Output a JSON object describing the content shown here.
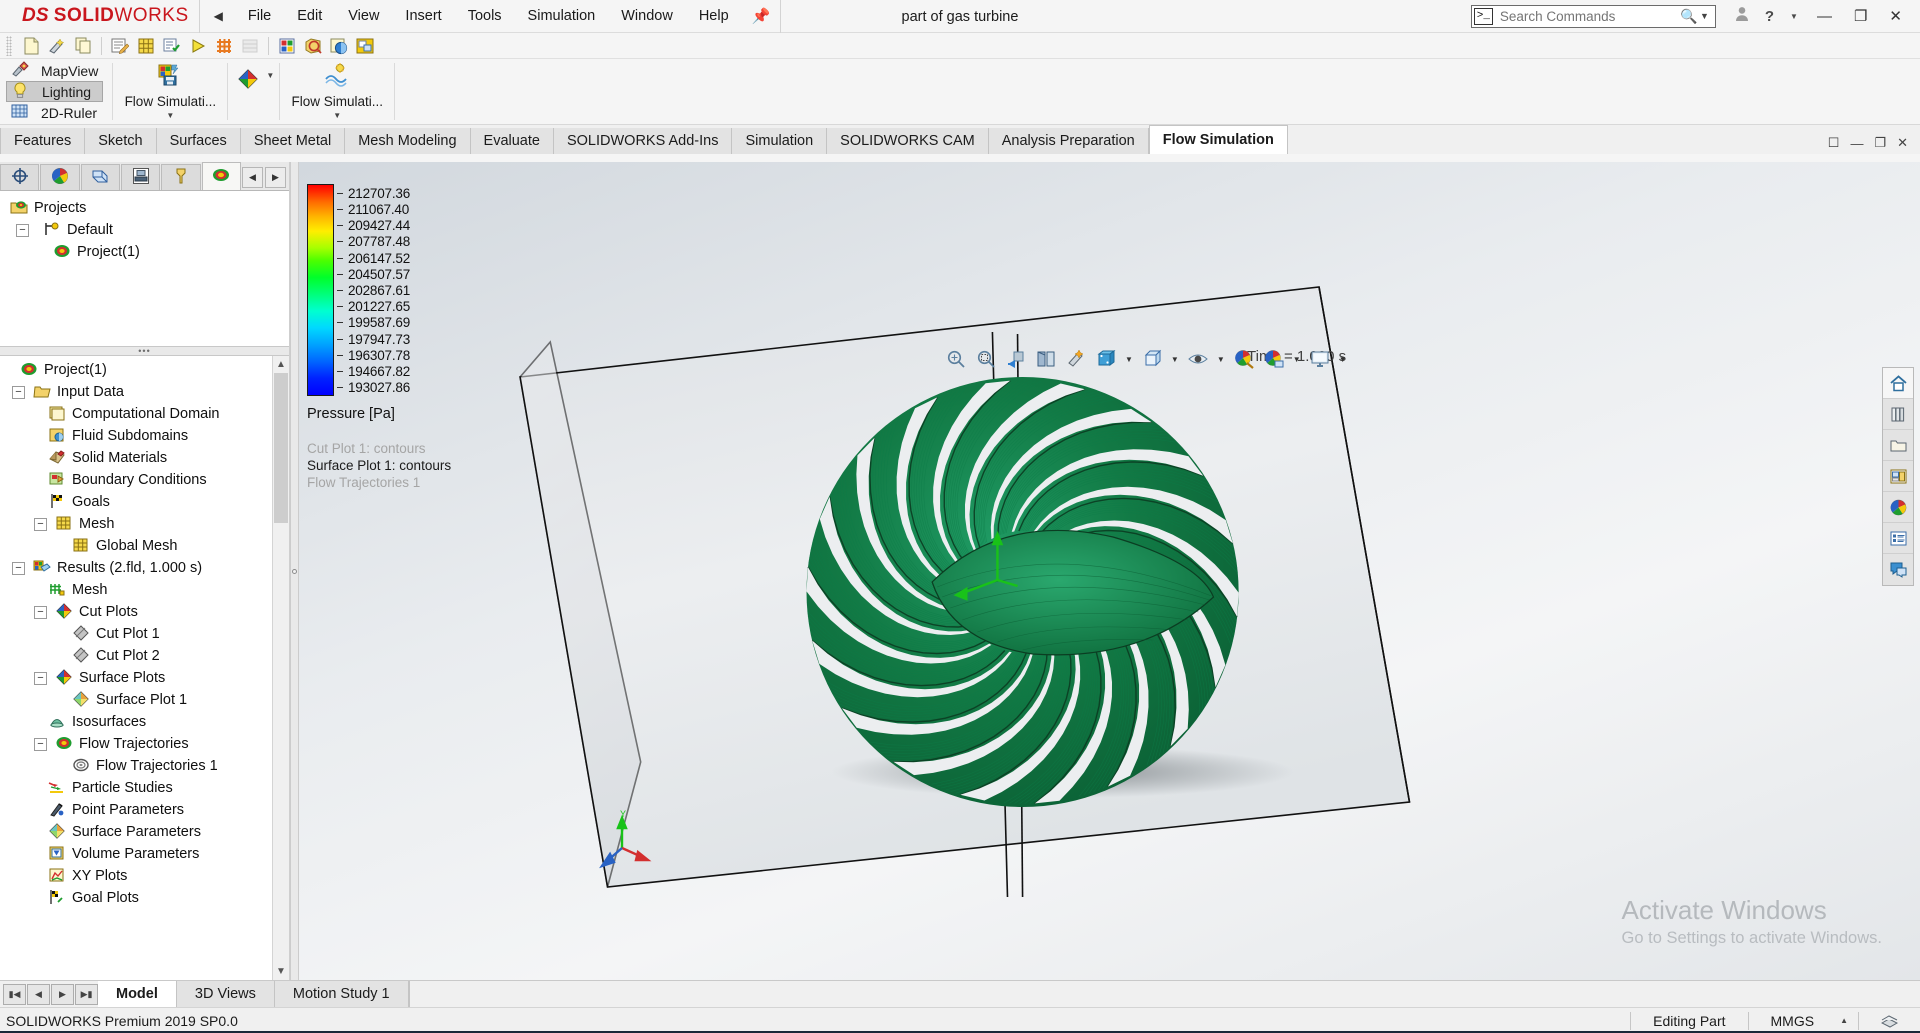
{
  "window": {
    "title": "part of gas turbine",
    "brand_ds": "DS",
    "brand_solid": "SOLID",
    "brand_works": "WORKS",
    "brand_color": "#c9161d"
  },
  "menu": {
    "collapse_icon": "chevron-left-icon",
    "items": [
      "File",
      "Edit",
      "View",
      "Insert",
      "Tools",
      "Simulation",
      "Window",
      "Help"
    ],
    "pin_icon": "pin-icon"
  },
  "search": {
    "placeholder": "Search Commands",
    "value": "",
    "icon": "search-icon",
    "dropdown_icon": "chevron-down-icon"
  },
  "title_right": {
    "account_icon": "user-account-icon",
    "help_icon": "help-icon",
    "help_caret": "chevron-down-icon",
    "minimize": "minimize-icon",
    "restore": "restore-icon",
    "close": "close-icon"
  },
  "quick_access": {
    "buttons": [
      "new-document-icon",
      "rebuild-icon",
      "copy-icon",
      "edit-definition-icon",
      "mesh-icon",
      "run-settings-icon",
      "run-icon",
      "mesh-grid-icon",
      "section-icon",
      "results-icon",
      "zoom-results-icon",
      "color-sphere-icon",
      "window-icon"
    ]
  },
  "ribbon": {
    "display_group": {
      "items": [
        {
          "label": "MapView",
          "icon": "mapview-icon",
          "selected": false
        },
        {
          "label": "Lighting",
          "icon": "lightbulb-icon",
          "selected": true
        },
        {
          "label": "2D-Ruler",
          "icon": "ruler-grid-icon",
          "selected": false
        }
      ]
    },
    "big_buttons": [
      {
        "label": "Flow Simulati...",
        "icon": "flow-simulation-project-icon",
        "dropdown": true
      },
      {
        "label": "Flow Simulati...",
        "icon": "flow-simulation-results-icon",
        "dropdown": true
      }
    ],
    "small_buttons": [
      {
        "icon": "flow-options-icon",
        "dropdown": true
      }
    ]
  },
  "tabs": {
    "items": [
      "Features",
      "Sketch",
      "Surfaces",
      "Sheet Metal",
      "Mesh Modeling",
      "Evaluate",
      "SOLIDWORKS Add-Ins",
      "Simulation",
      "SOLIDWORKS CAM",
      "Analysis Preparation",
      "Flow Simulation"
    ],
    "active": "Flow Simulation",
    "window_controls": [
      "pin-window-icon",
      "minimize-doc-icon",
      "restore-doc-icon",
      "close-doc-icon"
    ]
  },
  "left_panel": {
    "tabs": [
      {
        "icon": "feature-manager-icon",
        "active": false
      },
      {
        "icon": "property-manager-icon",
        "active": false
      },
      {
        "icon": "configuration-manager-icon",
        "active": false
      },
      {
        "icon": "dimxpert-manager-icon",
        "active": false
      },
      {
        "icon": "cam-manager-icon",
        "active": false
      },
      {
        "icon": "flow-simulation-manager-icon",
        "active": true
      }
    ],
    "nav_prev": "chevron-left-icon",
    "nav_next": "chevron-right-icon",
    "projects_tree": [
      {
        "label": "Projects",
        "depth": 0,
        "icon": "projects-folder-icon",
        "expander": ""
      },
      {
        "label": "Default",
        "depth": 1,
        "icon": "configuration-icon",
        "expander": "-"
      },
      {
        "label": "Project(1)",
        "depth": 2,
        "icon": "project-icon",
        "expander": ""
      }
    ],
    "splitter_dots": "•••",
    "study_tree": [
      {
        "label": "Project(1)",
        "depth": 0,
        "icon": "project-icon",
        "expander": ""
      },
      {
        "label": "Input Data",
        "depth": 1,
        "icon": "input-data-folder-icon",
        "expander": "-"
      },
      {
        "label": "Computational Domain",
        "depth": 2,
        "icon": "computational-domain-icon",
        "expander": ""
      },
      {
        "label": "Fluid Subdomains",
        "depth": 2,
        "icon": "fluid-subdomains-icon",
        "expander": ""
      },
      {
        "label": "Solid Materials",
        "depth": 2,
        "icon": "solid-materials-icon",
        "expander": ""
      },
      {
        "label": "Boundary Conditions",
        "depth": 2,
        "icon": "boundary-conditions-icon",
        "expander": ""
      },
      {
        "label": "Goals",
        "depth": 2,
        "icon": "goals-flag-icon",
        "expander": ""
      },
      {
        "label": "Mesh",
        "depth": 2,
        "icon": "mesh-icon",
        "expander": "-"
      },
      {
        "label": "Global Mesh",
        "depth": 3,
        "icon": "mesh-icon",
        "expander": ""
      },
      {
        "label": "Results (2.fld, 1.000 s)",
        "depth": 1,
        "icon": "results-icon",
        "expander": "-"
      },
      {
        "label": "Mesh",
        "depth": 2,
        "icon": "results-mesh-icon",
        "expander": ""
      },
      {
        "label": "Cut Plots",
        "depth": 2,
        "icon": "cut-plots-icon",
        "expander": "-"
      },
      {
        "label": "Cut Plot 1",
        "depth": 3,
        "icon": "cut-plot-item-icon",
        "expander": ""
      },
      {
        "label": "Cut Plot 2",
        "depth": 3,
        "icon": "cut-plot-item-icon",
        "expander": ""
      },
      {
        "label": "Surface Plots",
        "depth": 2,
        "icon": "surface-plots-icon",
        "expander": "-"
      },
      {
        "label": "Surface Plot 1",
        "depth": 3,
        "icon": "surface-plot-item-icon",
        "expander": ""
      },
      {
        "label": "Isosurfaces",
        "depth": 2,
        "icon": "isosurfaces-icon",
        "expander": ""
      },
      {
        "label": "Flow Trajectories",
        "depth": 2,
        "icon": "flow-trajectories-icon",
        "expander": "-"
      },
      {
        "label": "Flow Trajectories 1",
        "depth": 3,
        "icon": "flow-trajectory-item-icon",
        "expander": ""
      },
      {
        "label": "Particle Studies",
        "depth": 2,
        "icon": "particle-studies-icon",
        "expander": ""
      },
      {
        "label": "Point Parameters",
        "depth": 2,
        "icon": "point-parameters-icon",
        "expander": ""
      },
      {
        "label": "Surface Parameters",
        "depth": 2,
        "icon": "surface-parameters-icon",
        "expander": ""
      },
      {
        "label": "Volume Parameters",
        "depth": 2,
        "icon": "volume-parameters-icon",
        "expander": ""
      },
      {
        "label": "XY Plots",
        "depth": 2,
        "icon": "xy-plots-icon",
        "expander": ""
      },
      {
        "label": "Goal Plots",
        "depth": 2,
        "icon": "goal-plots-icon",
        "expander": ""
      }
    ]
  },
  "legend": {
    "title": "Pressure [Pa]",
    "unit": "Pa",
    "parameter": "Pressure",
    "values": [
      "212707.36",
      "211067.40",
      "209427.44",
      "207787.48",
      "206147.52",
      "204507.57",
      "202867.61",
      "201227.65",
      "199587.69",
      "197947.73",
      "196307.78",
      "194667.82",
      "193027.86"
    ],
    "min": 193027.86,
    "max": 212707.36,
    "colors_top_to_bottom": [
      "#ff0000",
      "#ff8800",
      "#ffff00",
      "#88ff00",
      "#00ff44",
      "#00ffcc",
      "#00aaff",
      "#0000ff"
    ]
  },
  "plot_captions": [
    {
      "text": "Cut Plot 1: contours",
      "active": false
    },
    {
      "text": "Surface Plot 1: contours",
      "active": true
    },
    {
      "text": "Flow Trajectories 1",
      "active": false
    }
  ],
  "graphics": {
    "time_label": "Time = 1.000 s",
    "view_toolbar": [
      "zoom-to-fit-icon",
      "zoom-to-area-icon",
      "previous-view-icon",
      "section-view-icon",
      "dynamic-annotation-icon",
      "view-orientation-icon",
      "display-style-icon",
      "hide-show-icon",
      "appearances-icon",
      "scene-icon",
      "view-settings-icon"
    ],
    "triad_labels": {
      "y": "Y",
      "x": "X",
      "z": "Z"
    }
  },
  "right_tools": [
    {
      "icon": "home-icon",
      "selected": true
    },
    {
      "icon": "design-library-icon",
      "selected": false
    },
    {
      "icon": "file-explorer-icon",
      "selected": false
    },
    {
      "icon": "view-palette-icon",
      "selected": false
    },
    {
      "icon": "appearances-sphere-icon",
      "selected": false
    },
    {
      "icon": "custom-properties-icon",
      "selected": false
    },
    {
      "icon": "flow-simulation-panel-icon",
      "selected": false
    }
  ],
  "watermark": {
    "line1": "Activate Windows",
    "line2": "Go to Settings to activate Windows."
  },
  "bottom": {
    "nav_buttons": [
      "first-icon",
      "previous-icon",
      "next-icon",
      "last-icon"
    ],
    "doc_tabs": [
      {
        "label": "Model",
        "active": true
      },
      {
        "label": "3D Views",
        "active": false
      },
      {
        "label": "Motion Study 1",
        "active": false
      }
    ]
  },
  "status": {
    "version": "SOLIDWORKS Premium 2019 SP0.0",
    "edit_mode": "Editing Part",
    "units": "MMGS",
    "units_caret": "chevron-up-icon",
    "overlay_icon": "document-stack-icon"
  }
}
